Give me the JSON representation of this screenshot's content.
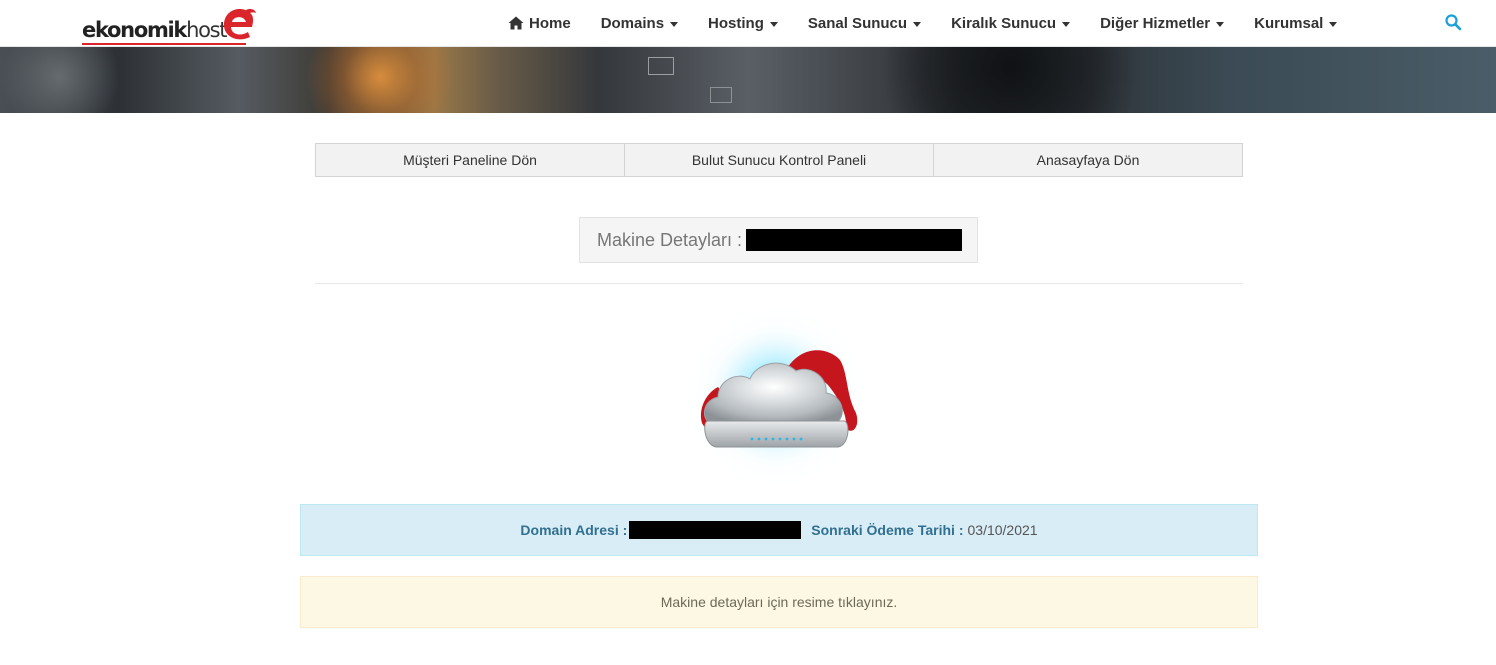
{
  "logo": {
    "bold": "ekonomik",
    "light": "host"
  },
  "nav": {
    "items": [
      {
        "label": "Home",
        "icon": "home-icon",
        "dropdown": false
      },
      {
        "label": "Domains",
        "dropdown": true
      },
      {
        "label": "Hosting",
        "dropdown": true
      },
      {
        "label": "Sanal Sunucu",
        "dropdown": true
      },
      {
        "label": "Kiralık Sunucu",
        "dropdown": true
      },
      {
        "label": "Diğer Hizmetler",
        "dropdown": true
      },
      {
        "label": "Kurumsal",
        "dropdown": true
      }
    ],
    "search_icon": "search-icon"
  },
  "tabs": [
    {
      "label": "Müşteri Paneline Dön"
    },
    {
      "label": "Bulut Sunucu Kontrol Paneli"
    },
    {
      "label": "Anasayfaya Dön"
    }
  ],
  "machine": {
    "label": "Makine Detayları :"
  },
  "info": {
    "domain_label": "Domain Adresi :",
    "payment_label": "Sonraki Ödeme Tarihi :",
    "payment_value": "03/10/2021"
  },
  "warning": {
    "text": "Makine detayları için resime tıklayınız."
  },
  "colors": {
    "brand_red": "#d9252b",
    "search_blue": "#1a9fd8",
    "info_bg": "#d9edf7",
    "info_text": "#31708f",
    "warning_bg": "#fcf8e3"
  }
}
